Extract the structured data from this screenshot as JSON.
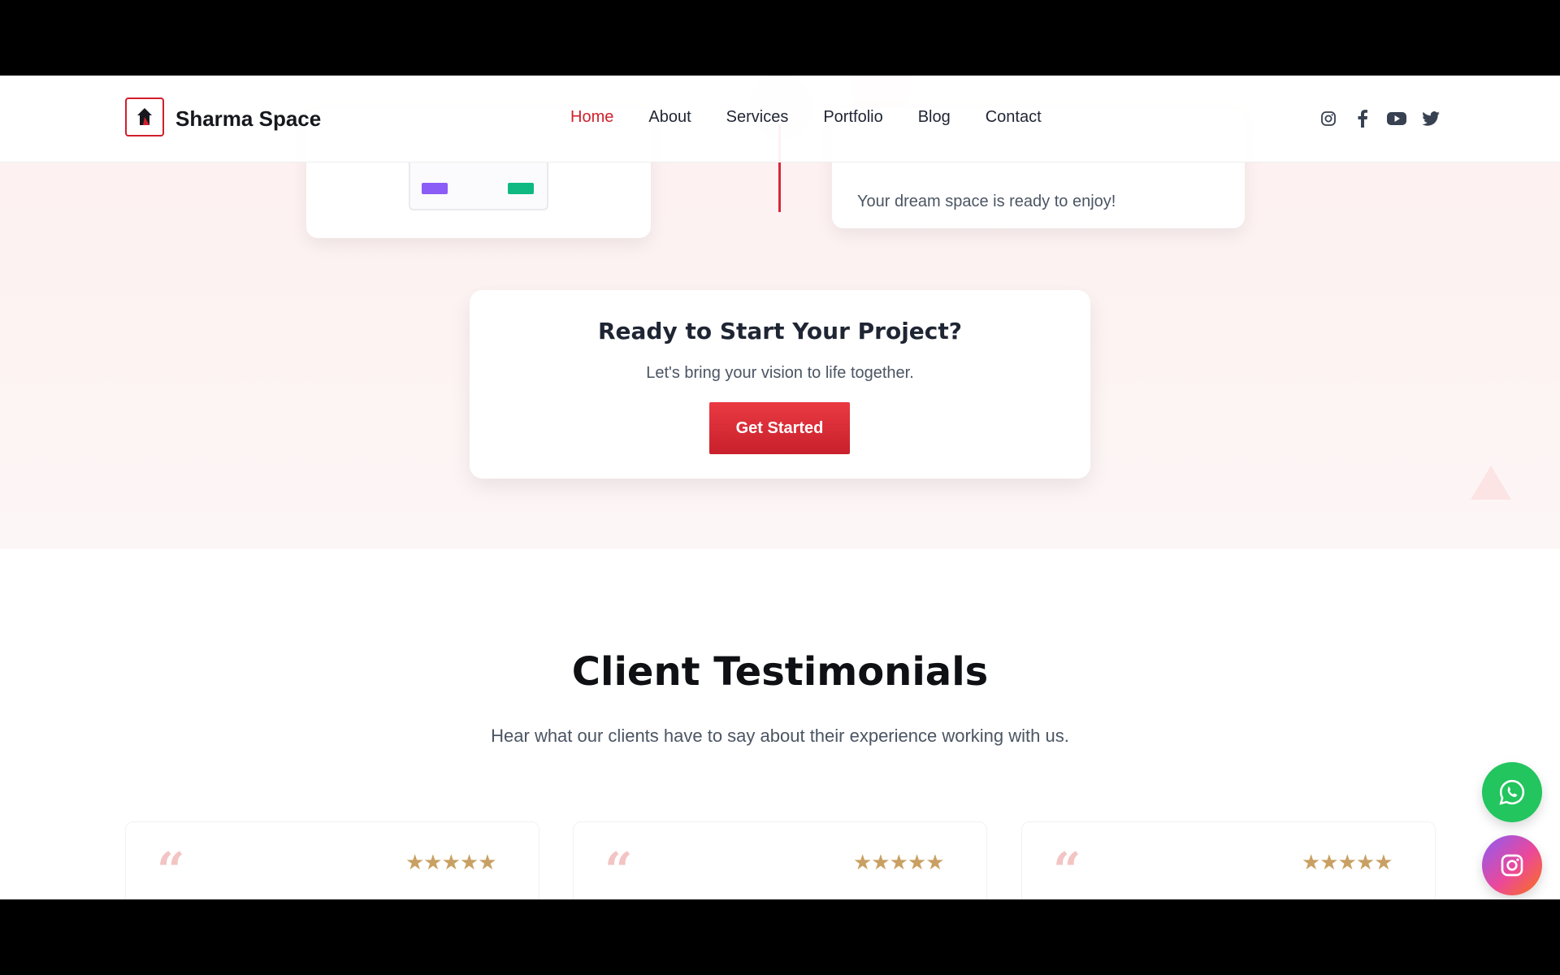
{
  "header": {
    "brand": "Sharma Space",
    "nav": [
      "Home",
      "About",
      "Services",
      "Portfolio",
      "Blog",
      "Contact"
    ],
    "active_nav": "Home",
    "socials": [
      "instagram-icon",
      "facebook-icon",
      "youtube-icon",
      "twitter-icon"
    ]
  },
  "process": {
    "final_step_text": "Your dream space is ready to enjoy!"
  },
  "cta": {
    "title": "Ready to Start Your Project?",
    "subtitle": "Let's bring your vision to life together.",
    "button": "Get Started"
  },
  "testimonials": {
    "title": "Client Testimonials",
    "subtitle": "Hear what our clients have to say about their experience working with us.",
    "cards": [
      {
        "rating": 5
      },
      {
        "rating": 5
      },
      {
        "rating": 5
      }
    ]
  },
  "floating": [
    "whatsapp-icon",
    "instagram-icon"
  ],
  "colors": {
    "accent": "#d0202c",
    "star": "#c9a063",
    "whatsapp": "#22c55e"
  }
}
